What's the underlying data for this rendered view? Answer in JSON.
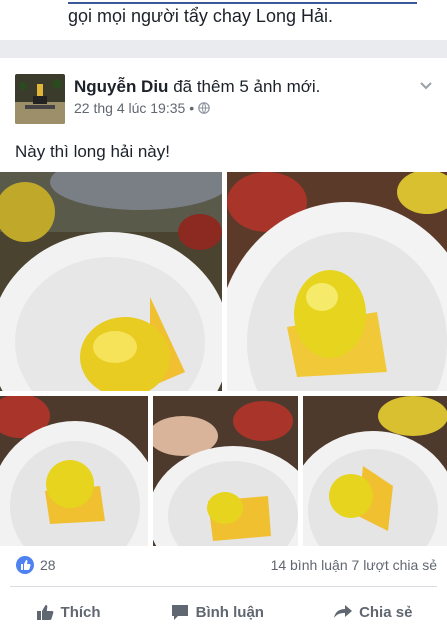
{
  "previous_post": {
    "text": "gọi mọi người tẩy chay Long Hải."
  },
  "post": {
    "author": "Nguyễn Diu",
    "action": "đã thêm 5 ảnh mới.",
    "timestamp": "22 thg 4 lúc 19:35 •",
    "privacy_icon": "globe-icon",
    "text": "Này thì long hải này!",
    "photo_count": 5
  },
  "stats": {
    "likes": "28",
    "comments_shares": "14 bình luận 7 lượt chia sẻ"
  },
  "actions": {
    "like_label": "Thích",
    "comment_label": "Bình luận",
    "share_label": "Chia sẻ"
  },
  "colors": {
    "brand": "#3b5998",
    "like_blue": "#4e81f1",
    "muted_text": "#616770",
    "jelly_yellow": "#f2d21c"
  }
}
